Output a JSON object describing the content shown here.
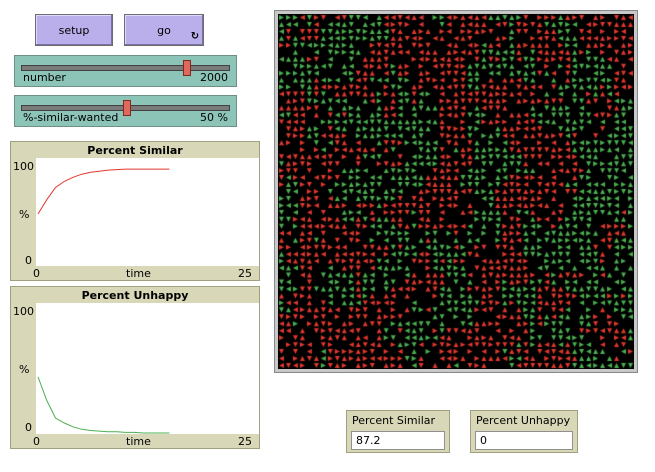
{
  "buttons": {
    "setup_label": "setup",
    "go_label": "go",
    "forever_icon": "forever-icon"
  },
  "sliders": {
    "number": {
      "label": "number",
      "value": "2000",
      "fraction": 0.8
    },
    "similar": {
      "label": "%-similar-wanted",
      "value": "50 %",
      "fraction": 0.5
    }
  },
  "plots": {
    "similar": {
      "title": "Percent Similar",
      "ymax": "100",
      "ylabel": "%",
      "ymin": "0",
      "xmin": "0",
      "xlabel": "time",
      "xmax": "25",
      "color": "#e0382e",
      "x": [
        0,
        1,
        2,
        3,
        4,
        5,
        6,
        7,
        8,
        9,
        10,
        11,
        12,
        13,
        14,
        15
      ],
      "y": [
        50,
        64,
        76,
        82,
        86,
        89,
        91,
        92,
        93,
        93.5,
        94,
        94,
        94,
        94,
        94,
        94
      ]
    },
    "unhappy": {
      "title": "Percent Unhappy",
      "ymax": "100",
      "ylabel": "%",
      "ymin": "0",
      "xmin": "0",
      "xlabel": "time",
      "xmax": "25",
      "color": "#4caf50",
      "x": [
        0,
        1,
        2,
        3,
        4,
        5,
        6,
        7,
        8,
        9,
        10,
        11,
        12,
        13,
        14,
        15
      ],
      "y": [
        45,
        26,
        12,
        8,
        5,
        3,
        2,
        1.5,
        1,
        1,
        0.5,
        0.5,
        0,
        0,
        0,
        0
      ]
    }
  },
  "view": {
    "colors": [
      "#e0382e",
      "#4caf50"
    ],
    "background": "#000000"
  },
  "monitors": {
    "similar": {
      "label": "Percent Similar",
      "value": "87.2"
    },
    "unhappy": {
      "label": "Percent Unhappy",
      "value": "0"
    }
  }
}
